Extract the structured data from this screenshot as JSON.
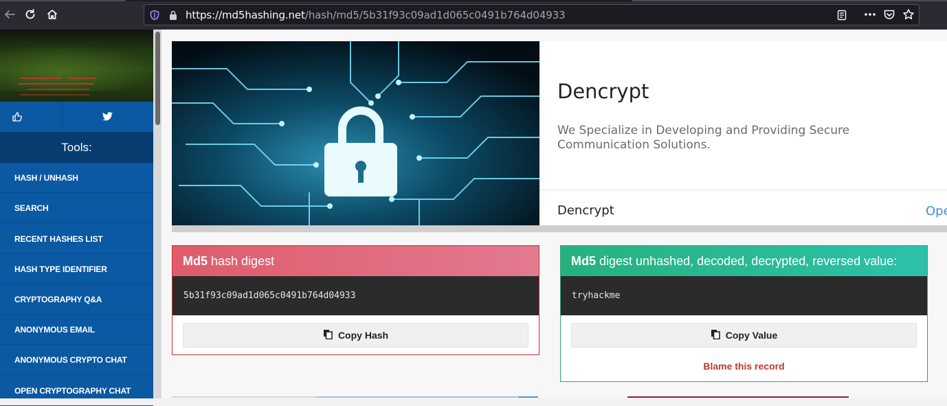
{
  "browser": {
    "url_domain": "https://md5hashing.net",
    "url_path": "/hash/md5/5b31f93c09ad1d065c0491b764d04933",
    "icons": [
      "back-icon",
      "reload-icon",
      "home-icon",
      "shield-icon",
      "lock-icon",
      "reader-view-icon",
      "more-icon",
      "pocket-icon",
      "bookmark-star-icon"
    ]
  },
  "sidebar": {
    "tools_header": "Tools:",
    "items": [
      {
        "label": "HASH / UNHASH"
      },
      {
        "label": "SEARCH"
      },
      {
        "label": "RECENT HASHES LIST"
      },
      {
        "label": "HASH TYPE IDENTIFIER"
      },
      {
        "label": "CRYPTOGRAPHY Q&A"
      },
      {
        "label": "ANONYMOUS EMAIL"
      },
      {
        "label": "ANONYMOUS CRYPTO CHAT"
      },
      {
        "label": "OPEN CRYPTOGRAPHY CHAT"
      }
    ],
    "social_icons": [
      "thumbs-up-icon",
      "twitter-icon"
    ]
  },
  "hero": {
    "title": "Dencrypt",
    "description": "We Specialize in Developing and Providing Secure Communication Solutions.",
    "footer_title": "Dencrypt",
    "footer_link": "Ope"
  },
  "hash_panel": {
    "algo": "Md5",
    "heading": "hash digest",
    "hash": "5b31f93c09ad1d065c0491b764d04933",
    "copy_label": "Copy Hash"
  },
  "value_panel": {
    "algo": "Md5",
    "heading": "digest unhashed, decoded, decrypted, reversed value:",
    "value": "tryhackme",
    "copy_label": "Copy Value",
    "blame_label": "Blame this record"
  },
  "colors": {
    "sidebar": "#0b58a3",
    "tools_header": "#083b70",
    "hash_border": "#c9302c",
    "value_border": "#2aa17c",
    "blame": "#c0392b"
  }
}
